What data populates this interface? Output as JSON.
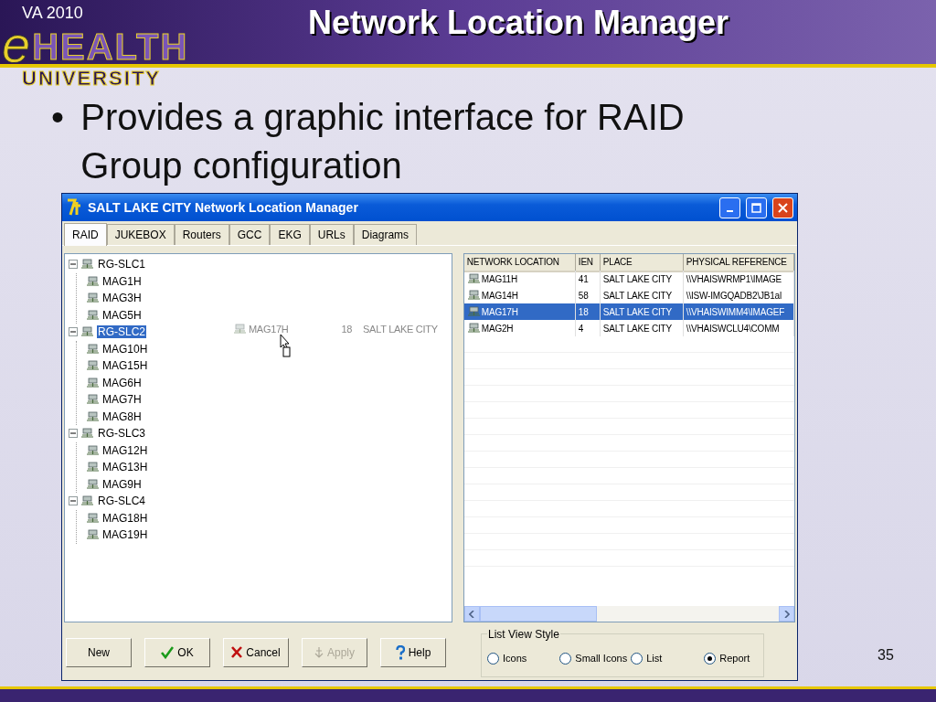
{
  "slide": {
    "title": "Network Location Manager",
    "logo": {
      "year": "VA 2010",
      "letter": "e",
      "word": "HEALTH",
      "school": "UNIVERSITY"
    },
    "bullet_mark": "•",
    "bullets": [
      "Provides a graphic interface for RAID Group configuration"
    ],
    "page_number": "35"
  },
  "window": {
    "title": "SALT LAKE CITY Network Location Manager",
    "tabs": [
      {
        "label": "RAID",
        "selected": true
      },
      {
        "label": "JUKEBOX",
        "selected": false
      },
      {
        "label": "Routers",
        "selected": false
      },
      {
        "label": "GCC",
        "selected": false
      },
      {
        "label": "EKG",
        "selected": false
      },
      {
        "label": "URLs",
        "selected": false
      },
      {
        "label": "Diagrams",
        "selected": false
      }
    ],
    "tree": [
      {
        "label": "RG-SLC1",
        "selected": false,
        "expanded": true,
        "children": [
          {
            "label": "MAG1H",
            "selected": false
          },
          {
            "label": "MAG3H",
            "selected": false
          },
          {
            "label": "MAG5H",
            "selected": false
          }
        ]
      },
      {
        "label": "RG-SLC2",
        "selected": true,
        "expanded": true,
        "children": [
          {
            "label": "MAG10H",
            "selected": false
          },
          {
            "label": "MAG15H",
            "selected": false
          },
          {
            "label": "MAG6H",
            "selected": false
          },
          {
            "label": "MAG7H",
            "selected": false
          },
          {
            "label": "MAG8H",
            "selected": false
          }
        ]
      },
      {
        "label": "RG-SLC3",
        "selected": false,
        "expanded": true,
        "children": [
          {
            "label": "MAG12H",
            "selected": false
          },
          {
            "label": "MAG13H",
            "selected": false
          },
          {
            "label": "MAG9H",
            "selected": false
          }
        ]
      },
      {
        "label": "RG-SLC4",
        "selected": false,
        "expanded": true,
        "children": [
          {
            "label": "MAG18H",
            "selected": false
          },
          {
            "label": "MAG19H",
            "selected": false
          }
        ]
      }
    ],
    "drag_ghost": {
      "location": "MAG17H",
      "ien": "18",
      "place": "SALT LAKE CITY"
    },
    "list": {
      "columns": [
        "NETWORK LOCATION",
        "IEN",
        "PLACE",
        "PHYSICAL REFERENCE"
      ],
      "rows": [
        {
          "cells": [
            "MAG11H",
            "41",
            "SALT LAKE CITY",
            "\\\\VHAISWRMP1\\IMAGE"
          ],
          "selected": false
        },
        {
          "cells": [
            "MAG14H",
            "58",
            "SALT LAKE CITY",
            "\\\\ISW-IMGQADB2\\JB1al"
          ],
          "selected": false
        },
        {
          "cells": [
            "MAG17H",
            "18",
            "SALT LAKE CITY",
            "\\\\VHAISWIMM4\\IMAGEF"
          ],
          "selected": true
        },
        {
          "cells": [
            "MAG2H",
            "4",
            "SALT LAKE CITY",
            "\\\\VHAISWCLU4\\COMM"
          ],
          "selected": false
        }
      ]
    },
    "buttons": [
      {
        "label": "New",
        "kind": "plain",
        "disabled": false
      },
      {
        "label": "OK",
        "kind": "check",
        "disabled": false
      },
      {
        "label": "Cancel",
        "kind": "cross",
        "disabled": false
      },
      {
        "label": "Apply",
        "kind": "apply",
        "disabled": true
      },
      {
        "label": "Help",
        "kind": "help",
        "disabled": false
      }
    ],
    "list_view_style": {
      "title": "List View Style",
      "options": [
        {
          "label": "Icons",
          "selected": false
        },
        {
          "label": "Small Icons",
          "selected": false
        },
        {
          "label": "List",
          "selected": false
        },
        {
          "label": "Report",
          "selected": true
        }
      ]
    }
  }
}
